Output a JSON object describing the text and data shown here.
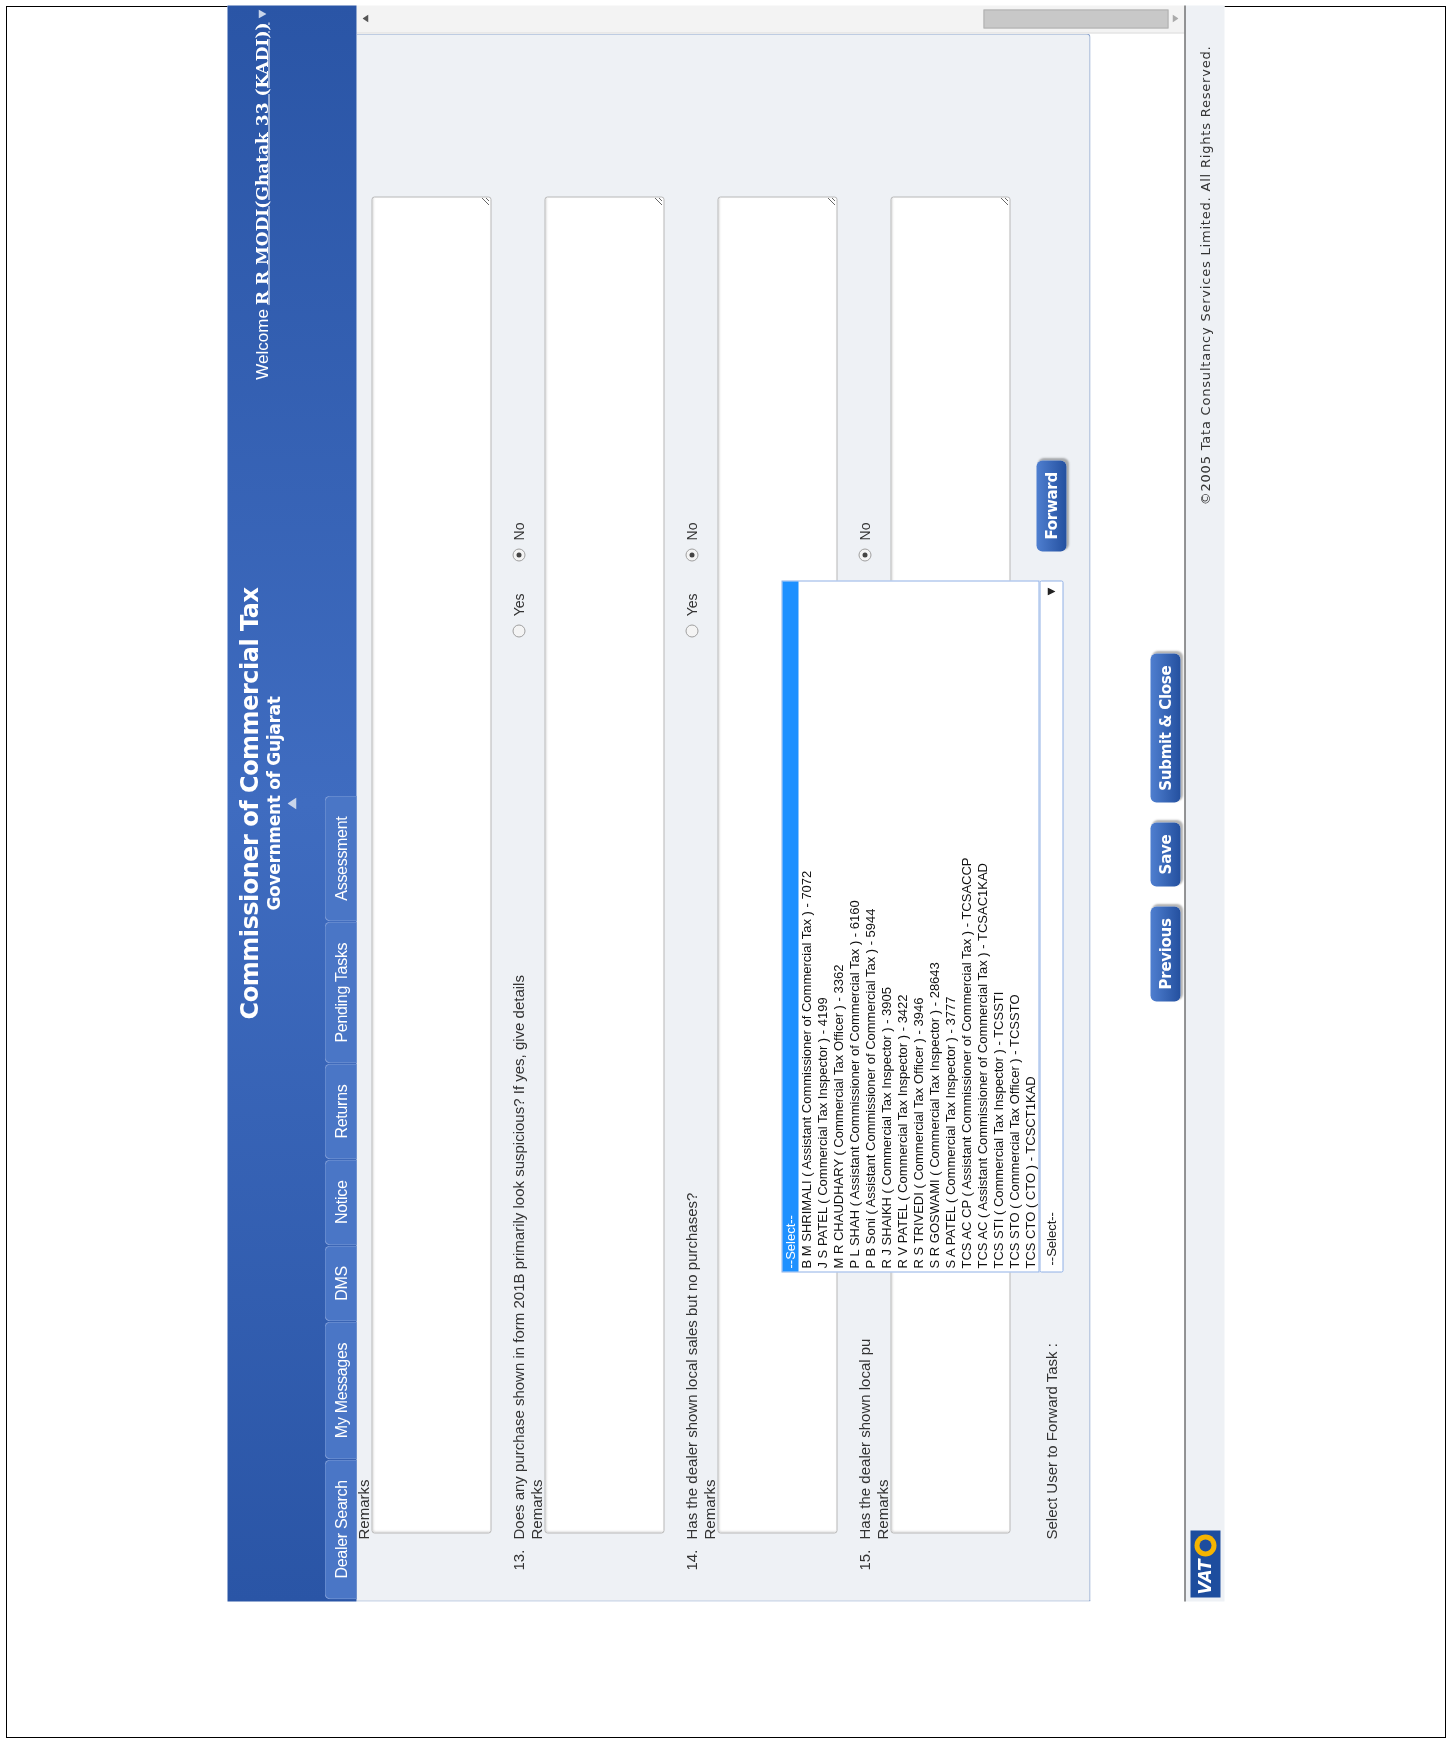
{
  "header": {
    "title": "Commissioner of Commercial Tax",
    "subtitle": "Government of Gujarat",
    "welcome_label": "Welcome",
    "user": "R R MODI(Ghatak 33 (KADI))"
  },
  "tabs": [
    {
      "label": "Dealer Search",
      "selected": false
    },
    {
      "label": "My Messages",
      "selected": false
    },
    {
      "label": "DMS",
      "selected": false
    },
    {
      "label": "Notice",
      "selected": false
    },
    {
      "label": "Returns",
      "selected": false
    },
    {
      "label": "Pending Tasks",
      "selected": false
    },
    {
      "label": "Assessment",
      "selected": false
    }
  ],
  "form": {
    "items": [
      {
        "kind": "remarks",
        "label": "Remarks"
      },
      {
        "kind": "question",
        "number": "13.",
        "text": "Does any purchase shown in form 201B primarily look suspicious? If yes, give details",
        "options": [
          {
            "label": "Yes",
            "selected": false
          },
          {
            "label": "No",
            "selected": true
          }
        ]
      },
      {
        "kind": "remarks",
        "label": "Remarks"
      },
      {
        "kind": "question",
        "number": "14.",
        "text": "Has the dealer shown local sales but no purchases?",
        "options": [
          {
            "label": "Yes",
            "selected": false
          },
          {
            "label": "No",
            "selected": true
          }
        ]
      },
      {
        "kind": "remarks",
        "label": "Remarks"
      },
      {
        "kind": "question",
        "number": "15.",
        "text": "Has the dealer shown local pu",
        "options": [
          {
            "label": "No",
            "selected": true
          }
        ]
      },
      {
        "kind": "remarks",
        "label": "Remarks"
      }
    ],
    "forward": {
      "label": "Select User to Forward Task :",
      "value": "--Select--",
      "button": "Forward",
      "options": [
        {
          "label": "--Select--",
          "selected": true
        },
        {
          "label": "B M SHRIMALI ( Assistant Commissioner of Commercial Tax ) - 7072",
          "selected": false
        },
        {
          "label": "J S PATEL ( Commercial Tax Inspector ) - 4199",
          "selected": false
        },
        {
          "label": "M R CHAUDHARY ( Commercial Tax Officer ) - 3362",
          "selected": false
        },
        {
          "label": "P L SHAH ( Assistant Commissioner of Commercial Tax ) - 6160",
          "selected": false
        },
        {
          "label": "P B Soni ( Assistant Commissioner of Commercial Tax ) - 5944",
          "selected": false
        },
        {
          "label": "R J SHAIKH ( Commercial Tax Inspector ) - 3905",
          "selected": false
        },
        {
          "label": "R V PATEL ( Commercial Tax Inspector ) - 3422",
          "selected": false
        },
        {
          "label": "R S TRIVEDI ( Commercial Tax Officer ) - 3946",
          "selected": false
        },
        {
          "label": "S R GOSWAMI ( Commercial Tax Inspector ) - 28643",
          "selected": false
        },
        {
          "label": "S A PATEL ( Commercial Tax Inspector ) - 3777",
          "selected": false
        },
        {
          "label": "TCS AC CP ( Assistant Commissioner of Commercial Tax ) - TCSACCP",
          "selected": false
        },
        {
          "label": "TCS AC ( Assistant Commissioner of Commercial Tax ) - TCSAC1KAD",
          "selected": false
        },
        {
          "label": "TCS STI ( Commercial Tax Inspector ) - TCSSTI",
          "selected": false
        },
        {
          "label": "TCS STO ( Commercial Tax Officer ) - TCSSTO",
          "selected": false
        },
        {
          "label": "TCS CTO ( CTO ) - TCSCT1KAD",
          "selected": false
        }
      ]
    }
  },
  "buttons": [
    "Previous",
    "Save",
    "Submit & Close"
  ],
  "footer": {
    "logo": "VAT",
    "copyright": "©2005 Tata Consultancy Services Limited. All Rights Reserved."
  }
}
